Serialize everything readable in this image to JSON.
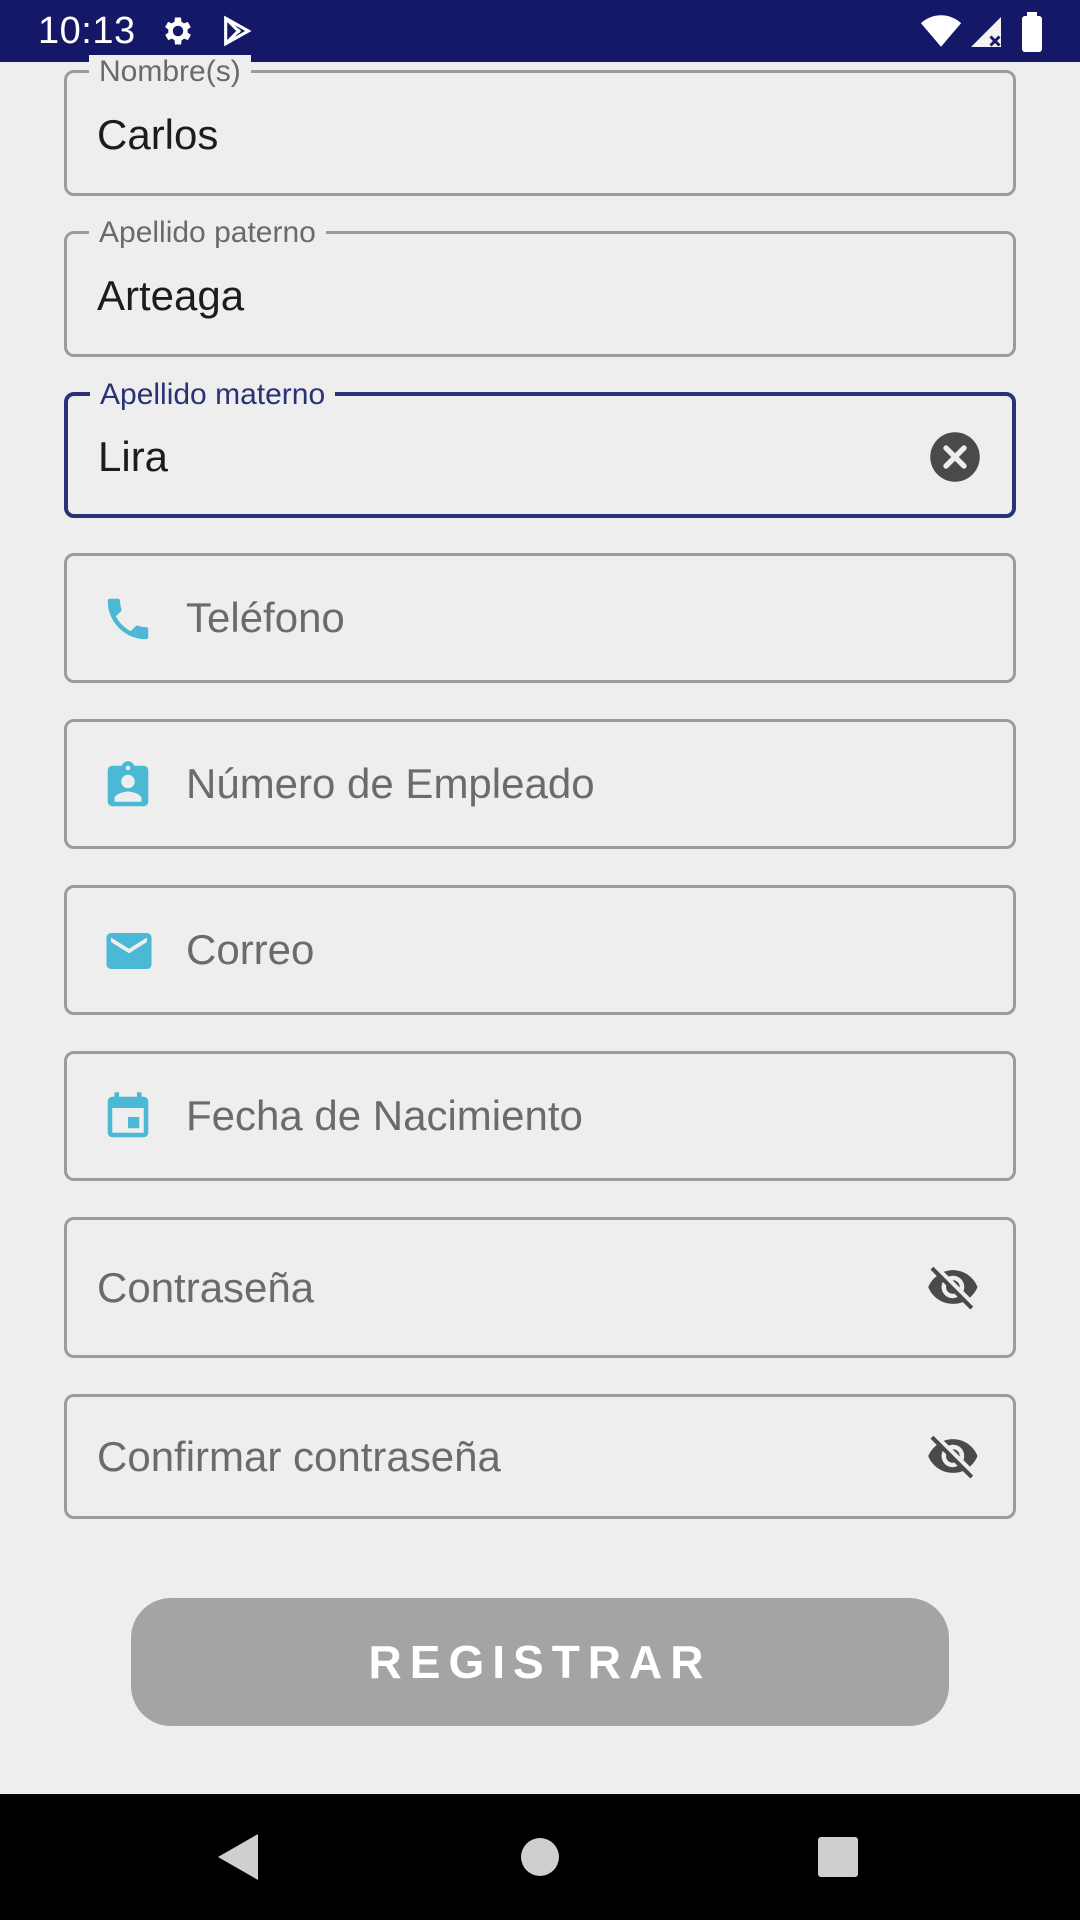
{
  "status_bar": {
    "time": "10:13",
    "icons": [
      "gear-icon",
      "play-store-icon",
      "wifi-icon",
      "signal-icon",
      "battery-icon"
    ]
  },
  "form": {
    "nombre": {
      "label": "Nombre(s)",
      "value": "Carlos"
    },
    "apellido_paterno": {
      "label": "Apellido paterno",
      "value": "Arteaga"
    },
    "apellido_materno": {
      "label": "Apellido materno",
      "value": "Lira",
      "trailing_icon": "clear-icon"
    },
    "telefono": {
      "placeholder": "Teléfono",
      "icon": "phone-icon"
    },
    "numero_empleado": {
      "placeholder": "Número de Empleado",
      "icon": "badge-icon"
    },
    "correo": {
      "placeholder": "Correo",
      "icon": "mail-icon"
    },
    "fecha_nacimiento": {
      "placeholder": "Fecha de Nacimiento",
      "icon": "calendar-icon"
    },
    "contrasena": {
      "placeholder": "Contraseña",
      "trailing_icon": "eye-off-icon"
    },
    "confirmar_contrasena": {
      "placeholder": "Confirmar contraseña",
      "trailing_icon": "eye-off-icon"
    }
  },
  "register_button": {
    "label": "REGISTRAR"
  },
  "nav_bar": {
    "buttons": [
      "back-icon",
      "home-icon",
      "recents-icon"
    ]
  },
  "colors": {
    "status_bar": "#151866",
    "focus": "#283274",
    "icon_accent": "#4bb8d6",
    "button_disabled": "#a4a4a4",
    "background": "#eeeeee"
  }
}
